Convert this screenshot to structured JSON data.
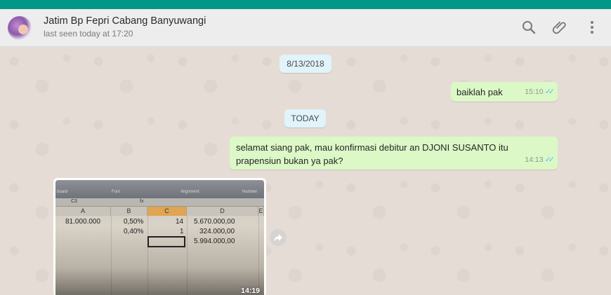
{
  "header": {
    "contact_name": "Jatim Bp Fepri Cabang Banyuwangi",
    "last_seen": "last seen today at 17:20",
    "icons": [
      "search-icon",
      "attach-icon",
      "menu-icon"
    ]
  },
  "chat": {
    "date_chip_1": "8/13/2018",
    "date_chip_2": "TODAY",
    "messages": [
      {
        "text": "baiklah pak",
        "time": "15:10",
        "status": "read"
      },
      {
        "text": "selamat siang pak, mau konfirmasi debitur an DJONI SUSANTO itu prapensiun bukan ya pak?",
        "time": "14:13",
        "status": "read"
      }
    ],
    "photo": {
      "time": "14:19",
      "spreadsheet": {
        "ribbon_groups": [
          "Font",
          "Alignment",
          "Number"
        ],
        "ribbon_left": "board",
        "name_box": "C3",
        "function_label": "fx",
        "columns": [
          "A",
          "B",
          "C",
          "D",
          "E"
        ],
        "rows": [
          [
            "81.000.000",
            "0,50%",
            "14",
            "5.670.000,00"
          ],
          [
            "",
            "0,40%",
            "1",
            "324.000,00"
          ],
          [
            "",
            "",
            "",
            "5.994.000,00"
          ]
        ]
      }
    }
  },
  "colors": {
    "topbar": "#009688",
    "outgoing_bubble": "#dcf8c6",
    "date_chip": "#e1f3fb",
    "read_ticks": "#4fc3f7"
  }
}
